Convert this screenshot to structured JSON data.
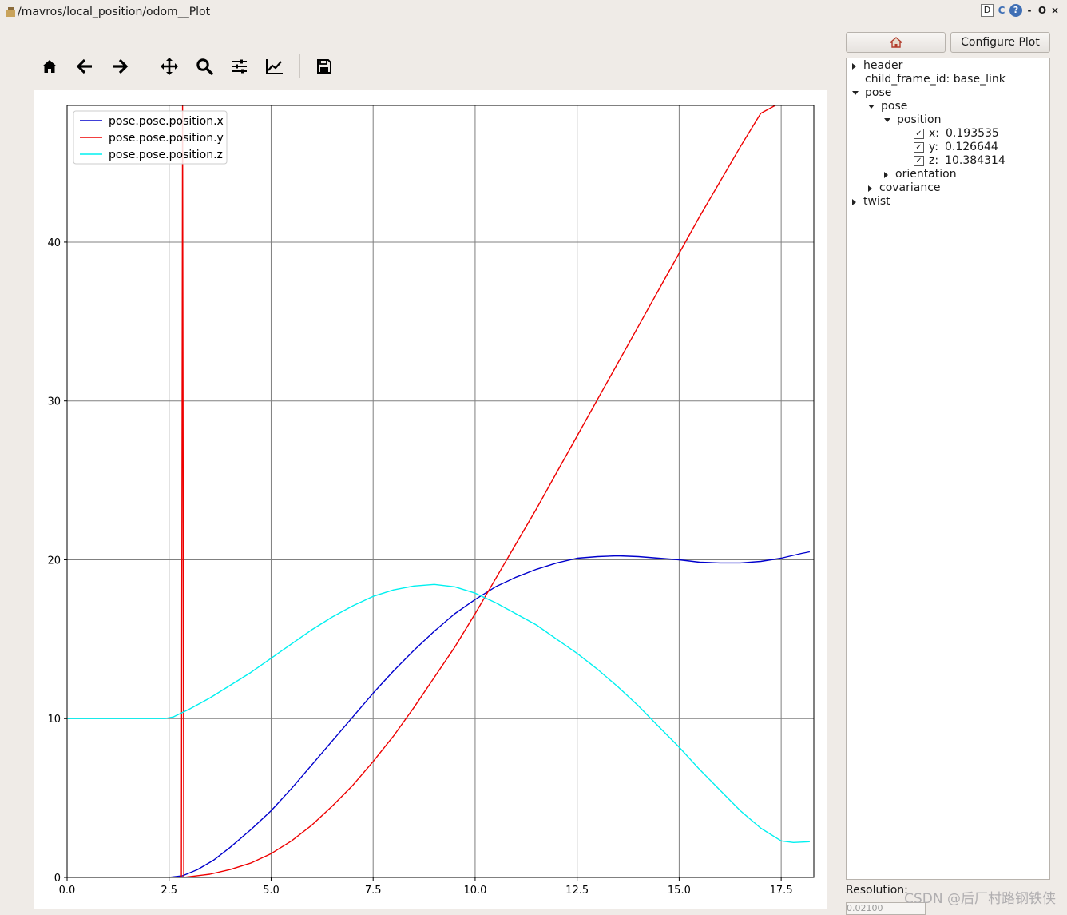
{
  "window": {
    "title": "/mavros/local_position/odom__Plot"
  },
  "title_controls": {
    "d_label": "D",
    "c_label": "C",
    "help_label": "?",
    "minimize_label": "-",
    "maximize_label": "O",
    "close_label": "×"
  },
  "toolbar": {
    "buttons": [
      {
        "name": "home",
        "icon": "home-icon"
      },
      {
        "name": "back",
        "icon": "arrow-left-icon"
      },
      {
        "name": "forward",
        "icon": "arrow-right-icon"
      },
      {
        "name": "pan",
        "icon": "move-icon"
      },
      {
        "name": "zoom",
        "icon": "magnifier-icon"
      },
      {
        "name": "configure-subplots",
        "icon": "sliders-icon"
      },
      {
        "name": "edit-axes",
        "icon": "line-chart-icon"
      },
      {
        "name": "save",
        "icon": "floppy-icon"
      }
    ]
  },
  "right_panel": {
    "home_button_icon": "house-icon",
    "configure_label": "Configure Plot",
    "tree": {
      "header": "header",
      "child_frame_id": "child_frame_id: base_link",
      "pose": "pose",
      "pose_pose": "pose",
      "position": "position",
      "x_key": "x:",
      "x_value": "0.193535",
      "y_key": "y:",
      "y_value": "0.126644",
      "z_key": "z:",
      "z_value": "10.384314",
      "orientation": "orientation",
      "covariance": "covariance",
      "twist": "twist"
    },
    "resolution_label": "Resolution:",
    "resolution_value": "0.02100"
  },
  "watermark": "CSDN @后厂村路钢铁侠",
  "chart_data": {
    "type": "line",
    "xlim": [
      0,
      18.3
    ],
    "ylim": [
      0,
      48.6
    ],
    "x_ticks": [
      0,
      2.5,
      5,
      7.5,
      10,
      12.5,
      15,
      17.5
    ],
    "x_tick_labels": [
      "0.0",
      "2.5",
      "5.0",
      "7.5",
      "10.0",
      "12.5",
      "15.0",
      "17.5"
    ],
    "y_ticks": [
      0,
      10,
      20,
      30,
      40
    ],
    "y_tick_labels": [
      "0",
      "10",
      "20",
      "30",
      "40"
    ],
    "grid": true,
    "legend": "top-left",
    "vertical_marker_x": 2.83,
    "series": [
      {
        "name": "pose.pose.position.x",
        "color": "#0000cc",
        "points": [
          [
            0,
            0
          ],
          [
            2.5,
            0
          ],
          [
            2.83,
            0.1
          ],
          [
            3.2,
            0.5
          ],
          [
            3.6,
            1.1
          ],
          [
            4.0,
            1.9
          ],
          [
            4.5,
            3.0
          ],
          [
            5.0,
            4.2
          ],
          [
            5.5,
            5.6
          ],
          [
            6.0,
            7.1
          ],
          [
            6.5,
            8.6
          ],
          [
            7.0,
            10.1
          ],
          [
            7.5,
            11.6
          ],
          [
            8.0,
            13.0
          ],
          [
            8.5,
            14.3
          ],
          [
            9.0,
            15.5
          ],
          [
            9.5,
            16.6
          ],
          [
            10.0,
            17.5
          ],
          [
            10.5,
            18.3
          ],
          [
            11.0,
            18.9
          ],
          [
            11.5,
            19.4
          ],
          [
            12.0,
            19.8
          ],
          [
            12.5,
            20.1
          ],
          [
            13.0,
            20.2
          ],
          [
            13.5,
            20.25
          ],
          [
            14.0,
            20.2
          ],
          [
            14.5,
            20.1
          ],
          [
            15.0,
            20.0
          ],
          [
            15.5,
            19.85
          ],
          [
            16.0,
            19.8
          ],
          [
            16.5,
            19.8
          ],
          [
            17.0,
            19.9
          ],
          [
            17.5,
            20.1
          ],
          [
            18.0,
            20.4
          ],
          [
            18.2,
            20.5
          ]
        ]
      },
      {
        "name": "pose.pose.position.y",
        "color": "#ee0000",
        "points": [
          [
            0,
            0
          ],
          [
            2.8,
            0
          ],
          [
            2.83,
            48.6
          ],
          [
            2.86,
            0
          ],
          [
            3.5,
            0.2
          ],
          [
            4.0,
            0.5
          ],
          [
            4.5,
            0.9
          ],
          [
            5.0,
            1.5
          ],
          [
            5.5,
            2.3
          ],
          [
            6.0,
            3.3
          ],
          [
            6.5,
            4.5
          ],
          [
            7.0,
            5.8
          ],
          [
            7.5,
            7.3
          ],
          [
            8.0,
            8.9
          ],
          [
            8.5,
            10.7
          ],
          [
            9.0,
            12.6
          ],
          [
            9.5,
            14.5
          ],
          [
            10.0,
            16.6
          ],
          [
            10.5,
            18.8
          ],
          [
            11.0,
            21.0
          ],
          [
            11.5,
            23.2
          ],
          [
            12.0,
            25.5
          ],
          [
            12.5,
            27.8
          ],
          [
            13.0,
            30.1
          ],
          [
            13.5,
            32.4
          ],
          [
            14.0,
            34.7
          ],
          [
            14.5,
            37.0
          ],
          [
            15.0,
            39.3
          ],
          [
            15.5,
            41.6
          ],
          [
            16.0,
            43.8
          ],
          [
            16.5,
            46.0
          ],
          [
            17.0,
            48.1
          ],
          [
            18.0,
            49.5
          ],
          [
            18.2,
            49.9
          ]
        ]
      },
      {
        "name": "pose.pose.position.z",
        "color": "#00f0f0",
        "points": [
          [
            0,
            10
          ],
          [
            2.4,
            10
          ],
          [
            2.6,
            10.1
          ],
          [
            3.0,
            10.6
          ],
          [
            3.5,
            11.3
          ],
          [
            4.0,
            12.1
          ],
          [
            4.5,
            12.9
          ],
          [
            5.0,
            13.8
          ],
          [
            5.5,
            14.7
          ],
          [
            6.0,
            15.6
          ],
          [
            6.5,
            16.4
          ],
          [
            7.0,
            17.1
          ],
          [
            7.5,
            17.7
          ],
          [
            8.0,
            18.1
          ],
          [
            8.5,
            18.35
          ],
          [
            9.0,
            18.45
          ],
          [
            9.5,
            18.3
          ],
          [
            10.0,
            17.9
          ],
          [
            10.5,
            17.3
          ],
          [
            11.0,
            16.6
          ],
          [
            11.5,
            15.9
          ],
          [
            12.0,
            15.0
          ],
          [
            12.5,
            14.1
          ],
          [
            13.0,
            13.1
          ],
          [
            13.5,
            12.0
          ],
          [
            14.0,
            10.8
          ],
          [
            14.5,
            9.5
          ],
          [
            15.0,
            8.2
          ],
          [
            15.5,
            6.8
          ],
          [
            16.0,
            5.5
          ],
          [
            16.5,
            4.2
          ],
          [
            17.0,
            3.1
          ],
          [
            17.5,
            2.3
          ],
          [
            17.8,
            2.2
          ],
          [
            18.2,
            2.25
          ]
        ]
      }
    ]
  }
}
